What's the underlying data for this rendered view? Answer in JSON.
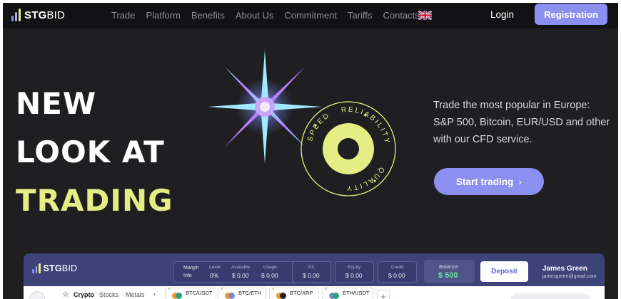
{
  "brand": {
    "name_bold": "STG",
    "name_light": "BID"
  },
  "nav": {
    "items": [
      "Trade",
      "Platform",
      "Benefits",
      "About Us",
      "Commitment",
      "Tariffs",
      "Contacts"
    ],
    "login": "Login",
    "register": "Registration"
  },
  "hero": {
    "line1": "NEW",
    "line2": "LOOK AT",
    "line3": "TRADING",
    "badge_words": [
      "SPEED",
      "RELIABILITY",
      "QUALITY"
    ],
    "tagline": "Trade the most popular in Europe: S&P 500, Bitcoin, EUR/USD and other with our CFD service.",
    "cta": "Start trading",
    "cta_chevron": "›"
  },
  "colors": {
    "accent": "#8b8ff0",
    "lime": "#e4ee84",
    "background": "#1f1f21",
    "panel": "#3d4378"
  },
  "app_preview": {
    "brand": {
      "name_bold": "STG",
      "name_light": "BID"
    },
    "margin_label": "Margin",
    "info_label": "Info",
    "level_label": "Level",
    "level_value": "0%",
    "available_label": "Available",
    "available_value": "$ 0.00",
    "usage_label": "Usage",
    "usage_value": "$ 0.00",
    "pl_label": "P/L",
    "pl_value": "$ 0.00",
    "equity_label": "Equity",
    "equity_value": "$ 0.00",
    "credit_label": "Credit",
    "credit_value": "$ 0.00",
    "balance_label": "Balance",
    "balance_value": "$ 500",
    "deposit": "Deposit",
    "user_name": "James Green",
    "user_email": "jamesgreen@gmail.com",
    "tabs": [
      "Crypto",
      "Stocks",
      "Metals"
    ],
    "pairs": [
      "BTC/USDT",
      "BTC/ETH",
      "BTC/XRP",
      "ETH/USDT"
    ],
    "plus": "+",
    "arrow": "›",
    "close": "×"
  }
}
